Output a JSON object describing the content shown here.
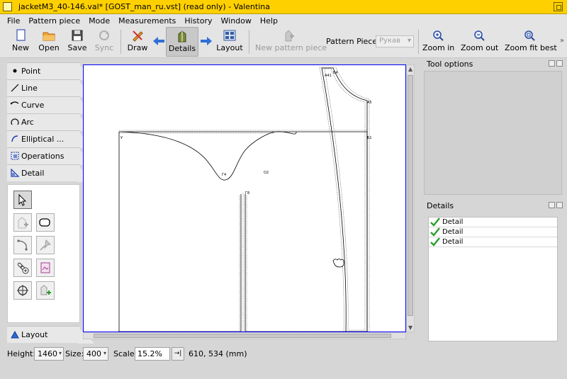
{
  "window": {
    "title": "jacketM3_40-146.val* [GOST_man_ru.vst] (read only) - Valentina"
  },
  "menu": [
    "File",
    "Pattern piece",
    "Mode",
    "Measurements",
    "History",
    "Window",
    "Help"
  ],
  "toolbar": {
    "new": "New",
    "open": "Open",
    "save": "Save",
    "sync": "Sync",
    "draw": "Draw",
    "details": "Details",
    "layout": "Layout",
    "new_pattern_piece": "New pattern piece",
    "pattern_piece_label": "Pattern Piece:",
    "pattern_piece_value": "Рукав",
    "zoom_in": "Zoom in",
    "zoom_out": "Zoom out",
    "zoom_fit_best": "Zoom fit best"
  },
  "toolbox": {
    "tabs": [
      "Point",
      "Line",
      "Curve",
      "Arc",
      "Elliptical ...",
      "Operations",
      "Detail"
    ],
    "bottom_tab": "Layout",
    "active_tab": "Detail"
  },
  "canvas": {
    "point_labels": [
      "А41",
      "Б4",
      "А5",
      "Б1",
      "Г4",
      "О2",
      "Г8",
      "У"
    ]
  },
  "tool_options": {
    "title": "Tool options"
  },
  "details": {
    "title": "Details",
    "items": [
      {
        "label": "Detail",
        "checked": true
      },
      {
        "label": "Detail",
        "checked": true
      },
      {
        "label": "Detail",
        "checked": true
      }
    ]
  },
  "status": {
    "height_label": "Height:",
    "height_value": "1460",
    "size_label": "Size:",
    "size_value": "400",
    "scale_label": "Scale:",
    "scale_value": "15.2%",
    "scale_btn": "→|",
    "coords": "610, 534 (mm)"
  },
  "colors": {
    "titlebar": "#ffd000",
    "canvas_border": "#0000ff",
    "check": "#2aa02a"
  }
}
